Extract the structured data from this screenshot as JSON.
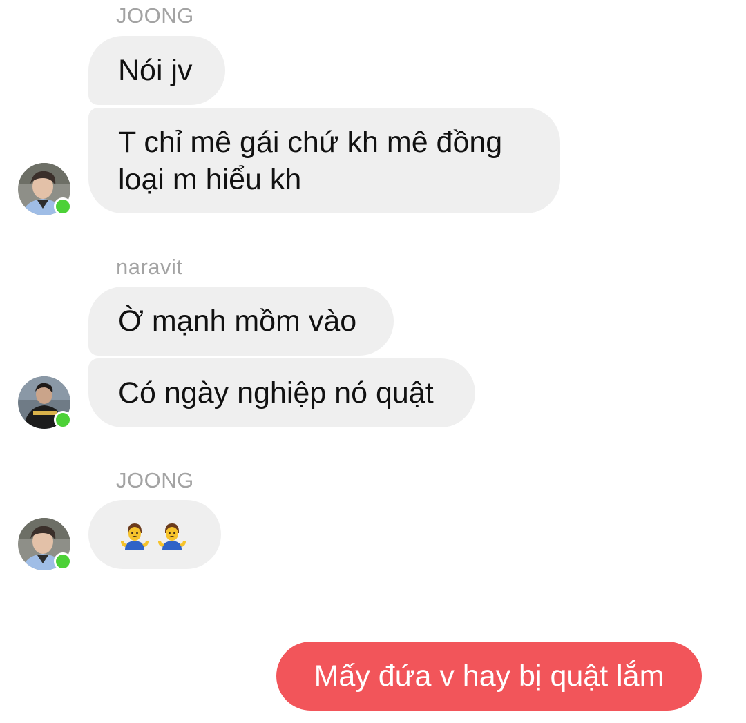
{
  "conversation": {
    "groups": [
      {
        "sender": "JOONG",
        "messages": [
          "Nói jv",
          "T chỉ mê gái chứ kh mê đồng loại m hiểu kh"
        ]
      },
      {
        "sender": "naravit",
        "messages": [
          "Ờ mạnh mồm vào",
          "Có ngày nghiệp nó quật"
        ]
      },
      {
        "sender": "JOONG",
        "messages": [
          "🤷‍♂️🤷‍♂️"
        ],
        "emoji_icons": [
          "man-shrugging-icon",
          "man-shrugging-icon"
        ]
      }
    ],
    "outgoing": {
      "text": "Mấy đứa v hay bị quật lắm"
    }
  },
  "colors": {
    "incoming_bubble": "#efefef",
    "outgoing_bubble": "#f2555a",
    "online_indicator": "#4cd137",
    "sender_name": "#a3a3a3"
  }
}
